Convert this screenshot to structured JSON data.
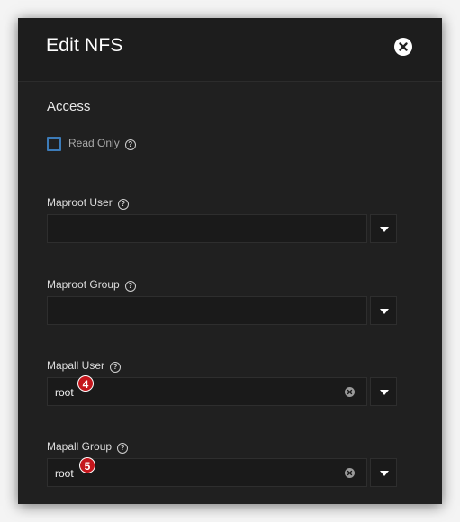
{
  "dialog": {
    "title": "Edit NFS",
    "close_icon": "close-icon"
  },
  "access": {
    "section_title": "Access",
    "read_only": {
      "label": "Read Only",
      "checked": false,
      "help_icon": "help-icon"
    }
  },
  "fields": {
    "maproot_user": {
      "label": "Maproot User",
      "value": ""
    },
    "maproot_group": {
      "label": "Maproot Group",
      "value": ""
    },
    "mapall_user": {
      "label": "Mapall User",
      "value": "root",
      "badge": "4"
    },
    "mapall_group": {
      "label": "Mapall Group",
      "value": "root",
      "badge": "5"
    }
  },
  "colors": {
    "accent": "#3c7bb8",
    "badge": "#c4161c",
    "background": "#202020"
  }
}
